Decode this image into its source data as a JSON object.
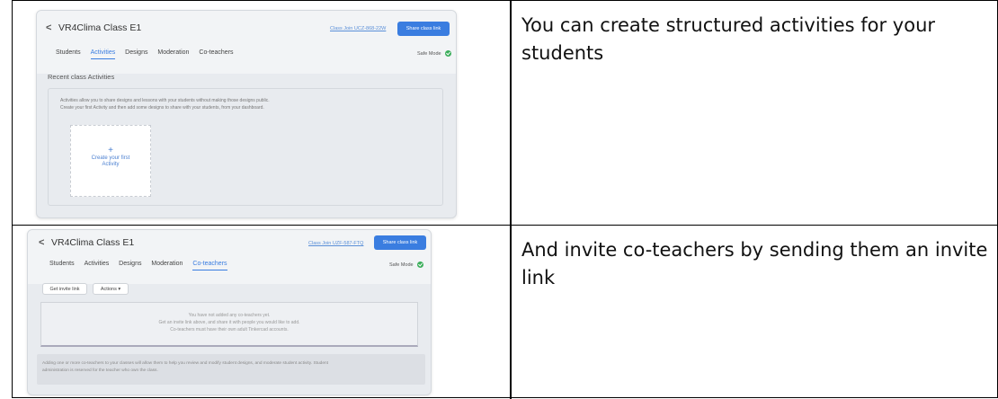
{
  "rows": [
    {
      "caption": "You can create structured activities for your students",
      "screenshot": {
        "title": "VR4Clima Class E1",
        "class_code": "Class Join UCZ-868-22W",
        "share_label": "Share class link",
        "tabs": [
          "Students",
          "Activities",
          "Designs",
          "Moderation",
          "Co-teachers"
        ],
        "active_tab": "Activities",
        "safe_mode": "Safe Mode",
        "section_title": "Recent class Activities",
        "info_lines": [
          "Activities allow you to share designs and lessons with your students without making those designs public.",
          "Create your first Activity and then add some designs to share with your students, from your dashboard."
        ],
        "create_label_1": "Create your first",
        "create_label_2": "Activity"
      }
    },
    {
      "caption": "And invite co-teachers by sending them an invite link",
      "screenshot": {
        "title": "VR4Clima Class E1",
        "class_code": "Class Join UZF-587-FTQ",
        "share_label": "Share class link",
        "tabs": [
          "Students",
          "Activities",
          "Designs",
          "Moderation",
          "Co-teachers"
        ],
        "active_tab": "Co-teachers",
        "safe_mode": "Safe Mode",
        "invite_button": "Get invite link",
        "actions_button": "Actions ▾",
        "empty_lines": [
          "You have not added any co-teachers yet.",
          "Get an invite link above, and share it with people you would like to add.",
          "Co-teachers must have their own adult Tinkercad accounts."
        ],
        "note_lines": [
          "Adding one or more co-teachers to your classes will allow them to help you review and modify student designs, and moderate student activity. Student",
          "administration is reserved for the teacher who own the class."
        ]
      }
    }
  ]
}
